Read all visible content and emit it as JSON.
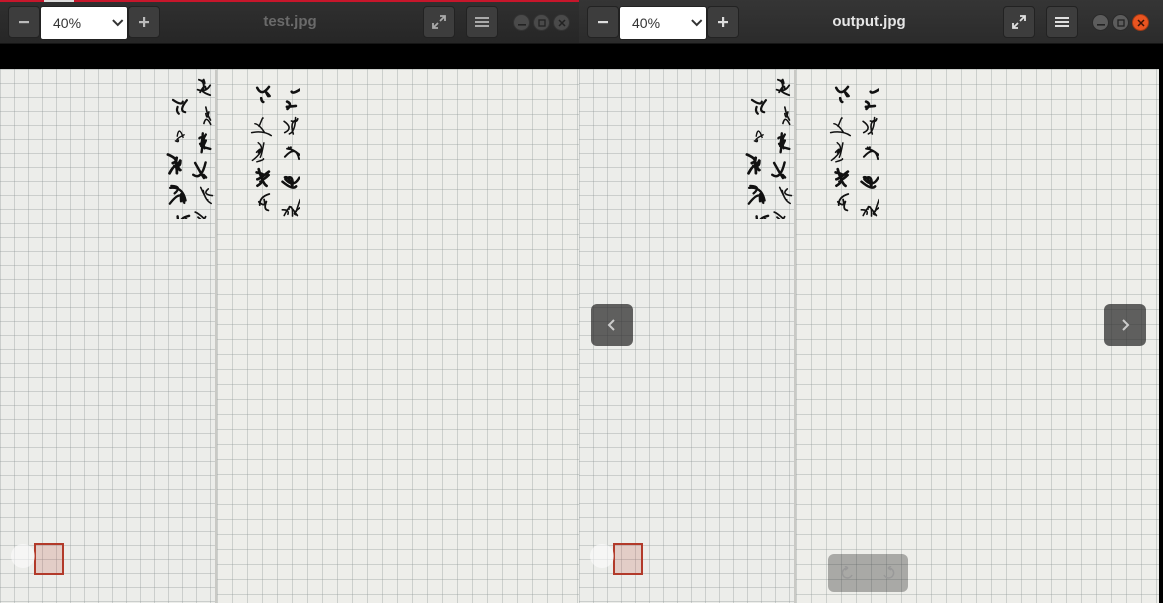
{
  "left_window": {
    "title": "test.jpg",
    "zoom": "40%",
    "focused": false,
    "icons": {
      "zoom_out": "minus-icon",
      "zoom_in": "plus-icon",
      "fullscreen": "fullscreen-icon",
      "menu": "hamburger-menu-icon"
    }
  },
  "right_window": {
    "title": "output.jpg",
    "zoom": "40%",
    "focused": true,
    "icons": {
      "zoom_out": "minus-icon",
      "zoom_in": "plus-icon",
      "fullscreen": "fullscreen-icon",
      "menu": "hamburger-menu-icon",
      "prev": "chevron-left-icon",
      "next": "chevron-right-icon",
      "rotate_left": "rotate-left-icon",
      "rotate_right": "rotate-right-icon"
    }
  },
  "colors": {
    "accent_close": "#e95420",
    "active_window_bar": "#c7162b",
    "paper": "#ecedea",
    "ink": "#111111"
  }
}
